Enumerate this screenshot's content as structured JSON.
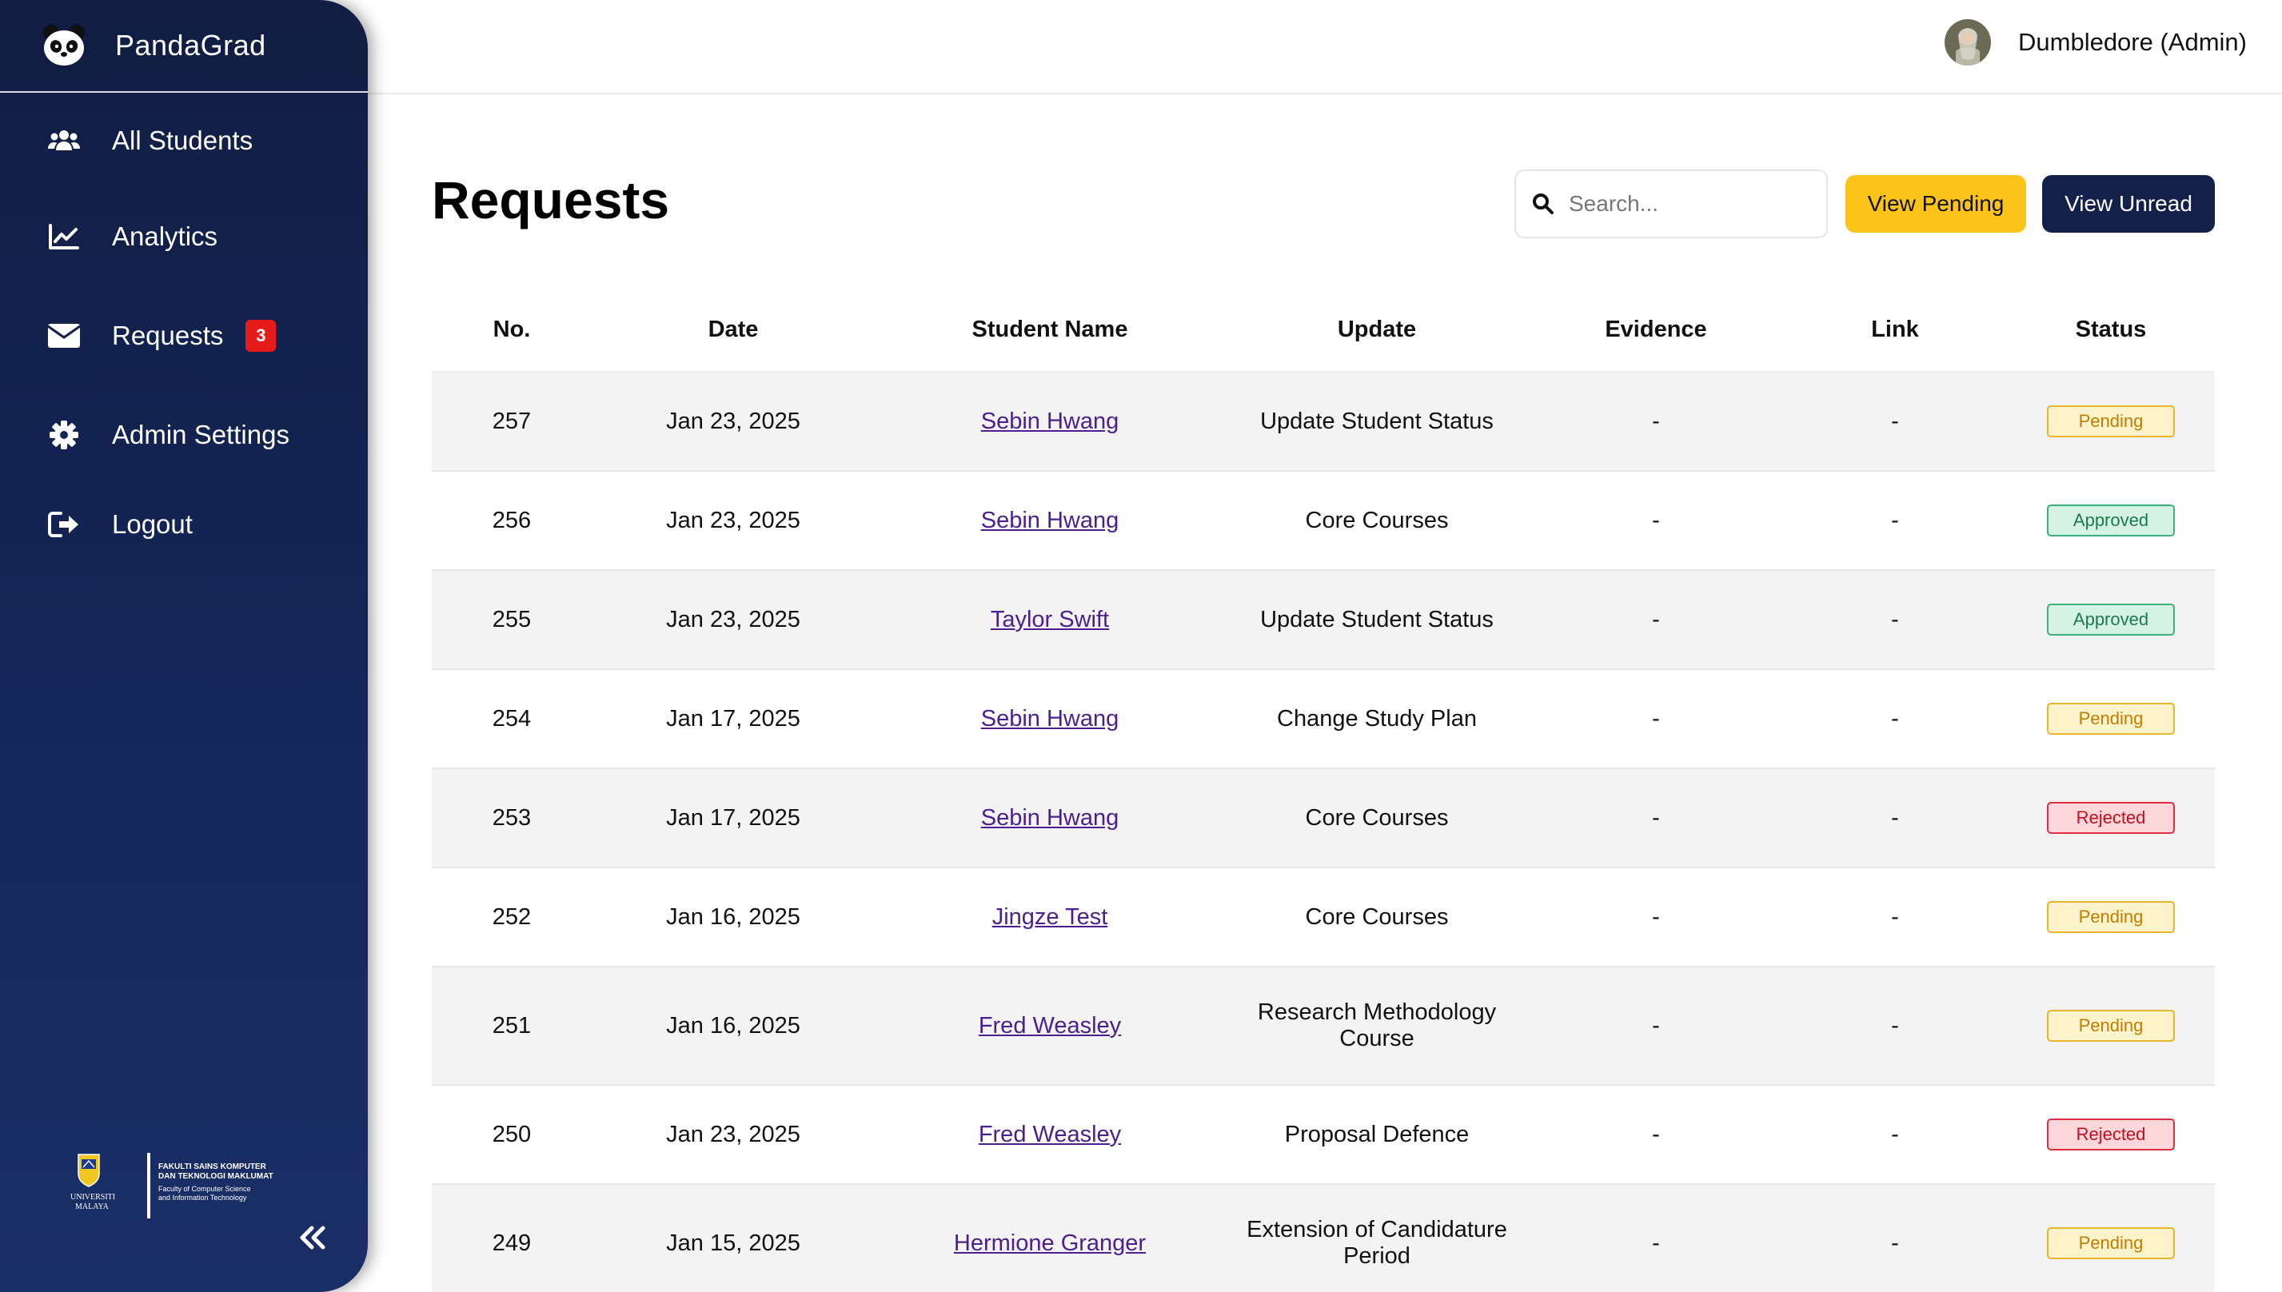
{
  "brand": {
    "name": "PandaGrad"
  },
  "sidebar": {
    "items": [
      {
        "label": "All Students",
        "icon": "users-icon"
      },
      {
        "label": "Analytics",
        "icon": "chart-line-icon"
      },
      {
        "label": "Requests",
        "icon": "envelope-icon",
        "badge": "3"
      },
      {
        "label": "Admin Settings",
        "icon": "gear-icon"
      },
      {
        "label": "Logout",
        "icon": "logout-icon"
      }
    ],
    "footer_logo": {
      "university": "UNIVERSITI MALAYA",
      "faculty_ms": "FAKULTI SAINS KOMPUTER DAN TEKNOLOGI MAKLUMAT",
      "faculty_en": "Faculty of Computer Science and Information Technology"
    }
  },
  "header": {
    "user_name": "Dumbledore (Admin)"
  },
  "main": {
    "title": "Requests",
    "search_placeholder": "Search...",
    "view_pending_label": "View Pending",
    "view_unread_label": "View Unread"
  },
  "table": {
    "columns": [
      "No.",
      "Date",
      "Student Name",
      "Update",
      "Evidence",
      "Link",
      "Status"
    ],
    "rows": [
      {
        "no": "257",
        "date": "Jan 23, 2025",
        "student": "Sebin Hwang",
        "update": [
          "Update Student Status"
        ],
        "evidence": "-",
        "link": "-",
        "status": "Pending"
      },
      {
        "no": "256",
        "date": "Jan 23, 2025",
        "student": "Sebin Hwang",
        "update": [
          "Core Courses"
        ],
        "evidence": "-",
        "link": "-",
        "status": "Approved"
      },
      {
        "no": "255",
        "date": "Jan 23, 2025",
        "student": "Taylor Swift",
        "update": [
          "Update Student Status"
        ],
        "evidence": "-",
        "link": "-",
        "status": "Approved"
      },
      {
        "no": "254",
        "date": "Jan 17, 2025",
        "student": "Sebin Hwang",
        "update": [
          "Change Study Plan"
        ],
        "evidence": "-",
        "link": "-",
        "status": "Pending"
      },
      {
        "no": "253",
        "date": "Jan 17, 2025",
        "student": "Sebin Hwang",
        "update": [
          "Core Courses"
        ],
        "evidence": "-",
        "link": "-",
        "status": "Rejected"
      },
      {
        "no": "252",
        "date": "Jan 16, 2025",
        "student": "Jingze Test",
        "update": [
          "Core Courses"
        ],
        "evidence": "-",
        "link": "-",
        "status": "Pending"
      },
      {
        "no": "251",
        "date": "Jan 16, 2025",
        "student": "Fred Weasley",
        "update": [
          "Research Methodology",
          "Course"
        ],
        "evidence": "-",
        "link": "-",
        "status": "Pending"
      },
      {
        "no": "250",
        "date": "Jan 23, 2025",
        "student": "Fred Weasley",
        "update": [
          "Proposal Defence"
        ],
        "evidence": "-",
        "link": "-",
        "status": "Rejected"
      },
      {
        "no": "249",
        "date": "Jan 15, 2025",
        "student": "Hermione Granger",
        "update": [
          "Extension of Candidature",
          "Period"
        ],
        "evidence": "-",
        "link": "-",
        "status": "Pending"
      }
    ]
  },
  "colors": {
    "sidebar": "#13204a",
    "pending_button": "#fcc419",
    "unread_button": "#13204a",
    "badge_red": "#e81b1b",
    "link": "#4b1f8f"
  }
}
